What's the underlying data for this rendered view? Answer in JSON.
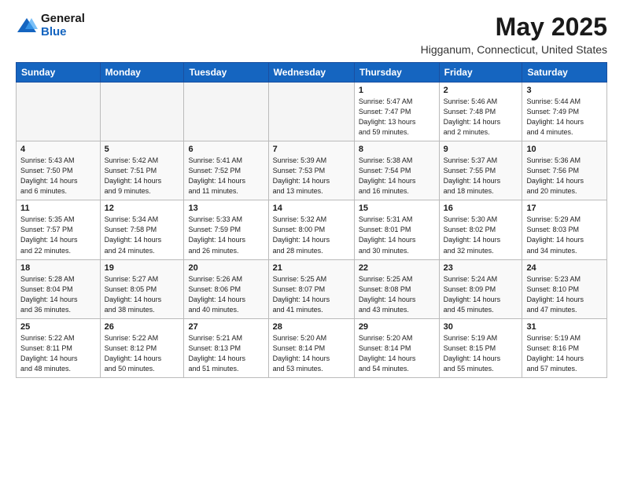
{
  "header": {
    "logo_general": "General",
    "logo_blue": "Blue",
    "month_title": "May 2025",
    "location": "Higganum, Connecticut, United States"
  },
  "days_of_week": [
    "Sunday",
    "Monday",
    "Tuesday",
    "Wednesday",
    "Thursday",
    "Friday",
    "Saturday"
  ],
  "weeks": [
    [
      {
        "day": "",
        "info": ""
      },
      {
        "day": "",
        "info": ""
      },
      {
        "day": "",
        "info": ""
      },
      {
        "day": "",
        "info": ""
      },
      {
        "day": "1",
        "info": "Sunrise: 5:47 AM\nSunset: 7:47 PM\nDaylight: 13 hours\nand 59 minutes."
      },
      {
        "day": "2",
        "info": "Sunrise: 5:46 AM\nSunset: 7:48 PM\nDaylight: 14 hours\nand 2 minutes."
      },
      {
        "day": "3",
        "info": "Sunrise: 5:44 AM\nSunset: 7:49 PM\nDaylight: 14 hours\nand 4 minutes."
      }
    ],
    [
      {
        "day": "4",
        "info": "Sunrise: 5:43 AM\nSunset: 7:50 PM\nDaylight: 14 hours\nand 6 minutes."
      },
      {
        "day": "5",
        "info": "Sunrise: 5:42 AM\nSunset: 7:51 PM\nDaylight: 14 hours\nand 9 minutes."
      },
      {
        "day": "6",
        "info": "Sunrise: 5:41 AM\nSunset: 7:52 PM\nDaylight: 14 hours\nand 11 minutes."
      },
      {
        "day": "7",
        "info": "Sunrise: 5:39 AM\nSunset: 7:53 PM\nDaylight: 14 hours\nand 13 minutes."
      },
      {
        "day": "8",
        "info": "Sunrise: 5:38 AM\nSunset: 7:54 PM\nDaylight: 14 hours\nand 16 minutes."
      },
      {
        "day": "9",
        "info": "Sunrise: 5:37 AM\nSunset: 7:55 PM\nDaylight: 14 hours\nand 18 minutes."
      },
      {
        "day": "10",
        "info": "Sunrise: 5:36 AM\nSunset: 7:56 PM\nDaylight: 14 hours\nand 20 minutes."
      }
    ],
    [
      {
        "day": "11",
        "info": "Sunrise: 5:35 AM\nSunset: 7:57 PM\nDaylight: 14 hours\nand 22 minutes."
      },
      {
        "day": "12",
        "info": "Sunrise: 5:34 AM\nSunset: 7:58 PM\nDaylight: 14 hours\nand 24 minutes."
      },
      {
        "day": "13",
        "info": "Sunrise: 5:33 AM\nSunset: 7:59 PM\nDaylight: 14 hours\nand 26 minutes."
      },
      {
        "day": "14",
        "info": "Sunrise: 5:32 AM\nSunset: 8:00 PM\nDaylight: 14 hours\nand 28 minutes."
      },
      {
        "day": "15",
        "info": "Sunrise: 5:31 AM\nSunset: 8:01 PM\nDaylight: 14 hours\nand 30 minutes."
      },
      {
        "day": "16",
        "info": "Sunrise: 5:30 AM\nSunset: 8:02 PM\nDaylight: 14 hours\nand 32 minutes."
      },
      {
        "day": "17",
        "info": "Sunrise: 5:29 AM\nSunset: 8:03 PM\nDaylight: 14 hours\nand 34 minutes."
      }
    ],
    [
      {
        "day": "18",
        "info": "Sunrise: 5:28 AM\nSunset: 8:04 PM\nDaylight: 14 hours\nand 36 minutes."
      },
      {
        "day": "19",
        "info": "Sunrise: 5:27 AM\nSunset: 8:05 PM\nDaylight: 14 hours\nand 38 minutes."
      },
      {
        "day": "20",
        "info": "Sunrise: 5:26 AM\nSunset: 8:06 PM\nDaylight: 14 hours\nand 40 minutes."
      },
      {
        "day": "21",
        "info": "Sunrise: 5:25 AM\nSunset: 8:07 PM\nDaylight: 14 hours\nand 41 minutes."
      },
      {
        "day": "22",
        "info": "Sunrise: 5:25 AM\nSunset: 8:08 PM\nDaylight: 14 hours\nand 43 minutes."
      },
      {
        "day": "23",
        "info": "Sunrise: 5:24 AM\nSunset: 8:09 PM\nDaylight: 14 hours\nand 45 minutes."
      },
      {
        "day": "24",
        "info": "Sunrise: 5:23 AM\nSunset: 8:10 PM\nDaylight: 14 hours\nand 47 minutes."
      }
    ],
    [
      {
        "day": "25",
        "info": "Sunrise: 5:22 AM\nSunset: 8:11 PM\nDaylight: 14 hours\nand 48 minutes."
      },
      {
        "day": "26",
        "info": "Sunrise: 5:22 AM\nSunset: 8:12 PM\nDaylight: 14 hours\nand 50 minutes."
      },
      {
        "day": "27",
        "info": "Sunrise: 5:21 AM\nSunset: 8:13 PM\nDaylight: 14 hours\nand 51 minutes."
      },
      {
        "day": "28",
        "info": "Sunrise: 5:20 AM\nSunset: 8:14 PM\nDaylight: 14 hours\nand 53 minutes."
      },
      {
        "day": "29",
        "info": "Sunrise: 5:20 AM\nSunset: 8:14 PM\nDaylight: 14 hours\nand 54 minutes."
      },
      {
        "day": "30",
        "info": "Sunrise: 5:19 AM\nSunset: 8:15 PM\nDaylight: 14 hours\nand 55 minutes."
      },
      {
        "day": "31",
        "info": "Sunrise: 5:19 AM\nSunset: 8:16 PM\nDaylight: 14 hours\nand 57 minutes."
      }
    ]
  ]
}
